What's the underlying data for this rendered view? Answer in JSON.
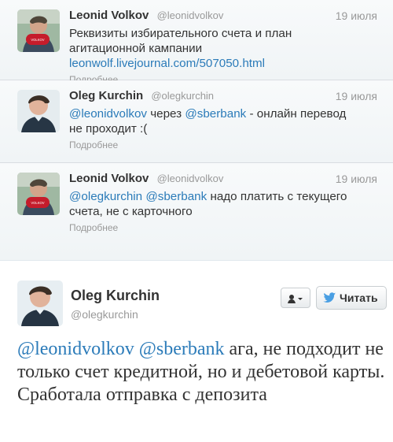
{
  "tweets": [
    {
      "fullname": "Leonid Volkov",
      "username": "@leonidvolkov",
      "timestamp": "19 июля",
      "text_line1": "Реквизиты избирательного счета и план",
      "text_line2": "агитационной кампании",
      "link": "leonwolf.livejournal.com/507050.html",
      "more": "Подробнее",
      "avatar": "leonid-volkov-avatar"
    },
    {
      "fullname": "Oleg Kurchin",
      "username": "@olegkurchin",
      "timestamp": "19 июля",
      "mention1": "@leonidvolkov",
      "middle": " через ",
      "mention2": "@sberbank",
      "text_tail": " - онлайн перевод",
      "text_line2": "не проходит :(",
      "more": "Подробнее",
      "avatar": "oleg-kurchin-avatar"
    },
    {
      "fullname": "Leonid Volkov",
      "username": "@leonidvolkov",
      "timestamp": "19 июля",
      "mention1": "@olegkurchin",
      "mention2": "@sberbank",
      "text_tail": " надо платить с текущего",
      "text_line2": "счета, не с карточного",
      "more": "Подробнее",
      "avatar": "leonid-volkov-avatar"
    }
  ],
  "expanded_tweet": {
    "fullname": "Oleg Kurchin",
    "username": "@olegkurchin",
    "mention1": "@leonidvolkov",
    "mention2": "@sberbank",
    "text_tail": " ага, не подходит не только счет кредитной, но и дебетовой карты. Сработала отправка с депозита",
    "follow_label": "Читать",
    "user_menu_icon": "person-dropdown-icon",
    "follow_icon": "twitter-bird-icon"
  },
  "colors": {
    "link": "#2b7bb9",
    "muted": "#999999",
    "text": "#333333",
    "timeline_bg": "#f5f8fa"
  }
}
